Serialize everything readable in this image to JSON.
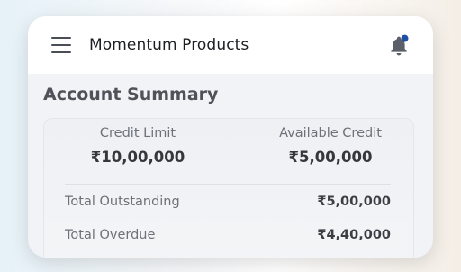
{
  "header": {
    "menu_icon": "hamburger-menu-icon",
    "title": "Momentum Products",
    "notification_icon": "bell-icon",
    "notification_dot_color": "#1f4fa3"
  },
  "account_summary": {
    "title": "Account Summary",
    "credit_limit": {
      "label": "Credit Limit",
      "value": "₹10,00,000"
    },
    "available_credit": {
      "label": "Available Credit",
      "value": "₹5,00,000"
    },
    "rows": [
      {
        "label": "Total Outstanding",
        "value": "₹5,00,000"
      },
      {
        "label": "Total Overdue",
        "value": "₹4,40,000"
      }
    ]
  }
}
